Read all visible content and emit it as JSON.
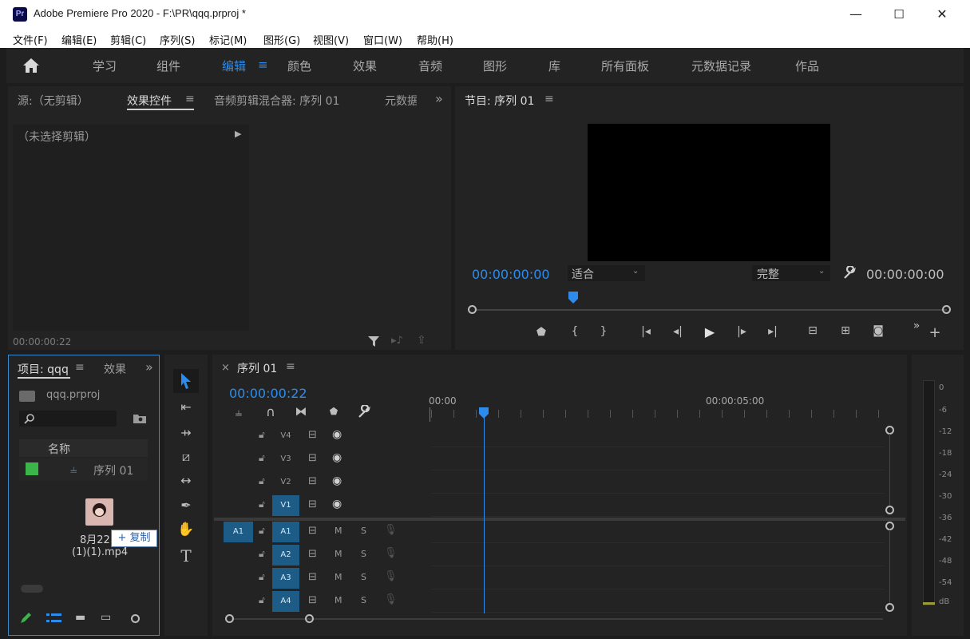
{
  "window": {
    "title": "Adobe Premiere Pro 2020 - F:\\PR\\qqq.prproj *",
    "app_badge": "Pr",
    "controls": [
      "—",
      "☐",
      "✕"
    ]
  },
  "menu": [
    "文件(F)",
    "编辑(E)",
    "剪辑(C)",
    "序列(S)",
    "标记(M)",
    "图形(G)",
    "视图(V)",
    "窗口(W)",
    "帮助(H)"
  ],
  "workspaces": {
    "items": [
      "学习",
      "组件",
      "编辑",
      "颜色",
      "效果",
      "音频",
      "图形",
      "库",
      "所有面板",
      "元数据记录",
      "作品"
    ],
    "active": "编辑",
    "active_menu_glyph": "≡"
  },
  "source_panel": {
    "tabs": [
      "源:（无剪辑）",
      "效果控件",
      "音频剪辑混合器: 序列 01",
      "元数据"
    ],
    "active_tab": "效果控件",
    "menu_glyph": "≡",
    "overflow_glyph": "»",
    "no_clip": "（未选择剪辑）",
    "timecode": "00:00:00:22"
  },
  "program_panel": {
    "tab": "节目: 序列 01",
    "menu_glyph": "≡",
    "timecode_left": "00:00:00:00",
    "timecode_right": "00:00:00:00",
    "fit": "适合",
    "quality": "完整"
  },
  "project_panel": {
    "tab": "项目: qqq",
    "tab2": "效果",
    "project_file": "qqq.prproj",
    "column_name": "名称",
    "items": [
      {
        "name": "序列 01",
        "color": "#3bb54a"
      }
    ],
    "clip_name_line1": "8月22",
    "clip_name_line2": "(1)(1).mp4",
    "copy_badge": "+ 复制"
  },
  "timeline": {
    "tab": "序列 01",
    "close_glyph": "×",
    "menu_glyph": "≡",
    "timecode": "00:00:00:22",
    "ruler": [
      "00:00",
      "00:00:05:00"
    ],
    "playhead_fraction": 0.116,
    "video_tracks": [
      "V4",
      "V3",
      "V2",
      "V1"
    ],
    "audio_tracks": [
      "A1",
      "A2",
      "A3",
      "A4"
    ],
    "source_patch": "A1",
    "mute": "M",
    "solo": "S"
  },
  "meter": {
    "ticks": [
      "0",
      "-6",
      "-12",
      "-18",
      "-24",
      "-30",
      "-36",
      "-42",
      "-48",
      "-54",
      "dB"
    ]
  },
  "colors": {
    "accent": "#2d8ceb",
    "panel": "#232323",
    "track_target": "#1c5c87"
  }
}
